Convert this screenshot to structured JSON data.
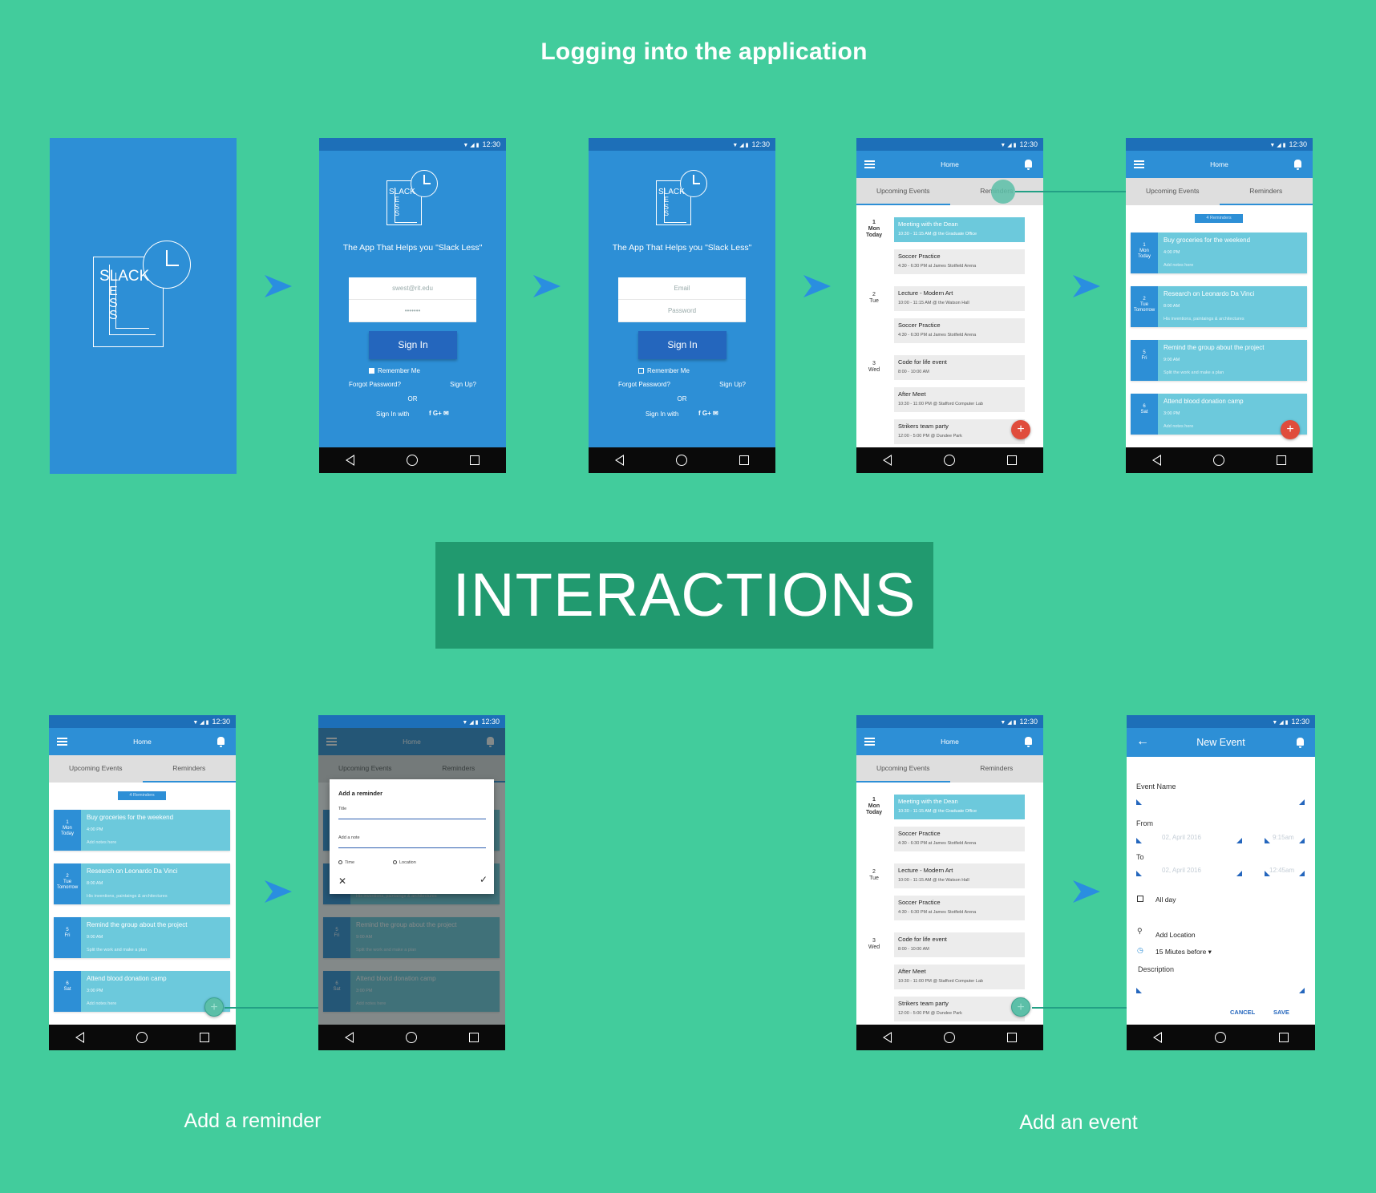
{
  "top_heading": "Logging into the application",
  "banner": "INTERACTIONS",
  "captions": {
    "reminder": "Add a reminder",
    "event": "Add an event"
  },
  "status": {
    "time": "12:30",
    "icons": "▼ ◢ ▮"
  },
  "logo": {
    "slack": "SLACK",
    "ess": "E S S",
    "slack_small": "SLACK"
  },
  "login": {
    "tagline": "The App That Helps you \"Slack Less\"",
    "filled_email": "swest@rit.edu",
    "filled_password": "•••••••",
    "email_placeholder": "Email",
    "password_placeholder": "Password",
    "signin": "Sign In",
    "remember": "Remember Me",
    "forgot": "Forgot Password?",
    "signup": "Sign Up?",
    "or": "OR",
    "signwith": "Sign In with",
    "social": "f   G+  ✉"
  },
  "home": {
    "title": "Home",
    "tab_events": "Upcoming Events",
    "tab_reminders": "Reminders",
    "days": [
      {
        "num": "1",
        "name": "Mon",
        "extra": "Today"
      },
      {
        "num": "2",
        "name": "Tue",
        "extra": ""
      },
      {
        "num": "3",
        "name": "Wed",
        "extra": ""
      }
    ],
    "events": [
      {
        "title": "Meeting with the Dean",
        "sub": "10:30 - 11:15 AM @ the Graduate Office"
      },
      {
        "title": "Soccer Practice",
        "sub": "4:30 - 6:30 PM at James Stotfield Arena"
      },
      {
        "title": "Lecture - Modern Art",
        "sub": "10:00 - 11:15 AM @ the Watson Hall"
      },
      {
        "title": "Soccer Practice",
        "sub": "4:30 - 6:30 PM at James Stotfield Arena"
      },
      {
        "title": "Code for life event",
        "sub": "8:00 - 10:00 AM"
      },
      {
        "title": "After Meet",
        "sub": "10:30 - 11:00 PM @ Stafford Computer Lab"
      },
      {
        "title": "Strikers team party",
        "sub": "12:00 - 5:00 PM @ Dundee Park"
      }
    ]
  },
  "reminders": {
    "count": "4 Reminders",
    "items": [
      {
        "d1": "1",
        "d2": "Mon",
        "d3": "Today",
        "title": "Buy groceries for the weekend",
        "time": "4:00 PM",
        "note": "Add notes here"
      },
      {
        "d1": "2",
        "d2": "Tue",
        "d3": "Tomorrow",
        "title": "Research on Leonardo Da Vinci",
        "time": "8:00 AM",
        "note": "His inventions, paintaings & architectures"
      },
      {
        "d1": "5",
        "d2": "Fri",
        "d3": "",
        "title": "Remind the group about the project",
        "time": "9:00 AM",
        "note": "Split the work and make a plan"
      },
      {
        "d1": "6",
        "d2": "Sat",
        "d3": "",
        "title": "Attend blood donation camp",
        "time": "3:00 PM",
        "note": "Add notes here"
      }
    ]
  },
  "dialog": {
    "title": "Add a reminder",
    "field_title": "Title",
    "field_note": "Add a note",
    "opt_time": "Time",
    "opt_location": "Location"
  },
  "new_event": {
    "title": "New Event",
    "event_name": "Event Name",
    "from": "From",
    "to": "To",
    "from_date": "02, April 2016",
    "from_time": "9:15am",
    "to_date": "02, April 2016",
    "to_time": "12:45am",
    "all_day": "All day",
    "add_location": "Add Location",
    "reminder": "15 Miutes before ▾",
    "description": "Description",
    "cancel": "CANCEL",
    "save": "SAVE"
  },
  "colors": {
    "background": "#42cc9c",
    "primary": "#2d8fd6",
    "banner": "#219a6f",
    "highlight": "#6cc9dc",
    "fab": "#e04c3c"
  }
}
